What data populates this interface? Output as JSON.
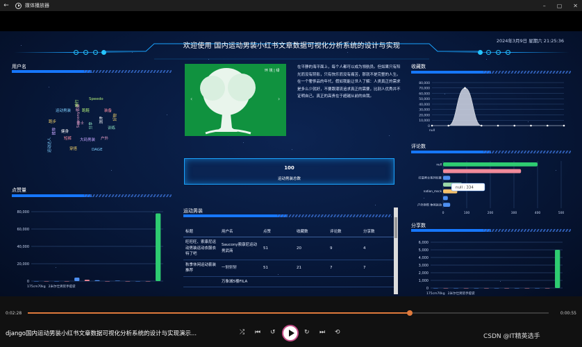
{
  "window": {
    "title": "媒体播放器",
    "back": "←",
    "minimize": "–",
    "maximize": "▢",
    "close": "✕"
  },
  "dashboard": {
    "title": "欢迎使用 国内运动男装小红书文章数据可视化分析系统的设计与实现",
    "datetime": "2024年3月9日 星期六 21:25:36",
    "panels": {
      "username": "用户名",
      "likes": "点赞量",
      "favorites": "收藏数",
      "comments": "评论数",
      "shares": "分享数",
      "sports_menswear": "运动男装"
    },
    "wordcloud": [
      "Saucony索康",
      "运动男装",
      "跑步",
      "骑行",
      "健身",
      "装备",
      "分享",
      "大码男装",
      "户外",
      "运动达人",
      "穿搭",
      "Speedo",
      "测评",
      "短裤",
      "训练",
      "推荐",
      "男士",
      "DAGE",
      "好物",
      "跑鞋"
    ],
    "image_overlay_text": "环 境 | 绿",
    "intro": "在平静的海平面上，每个人都可以成为领航员。但如果只有阳光而没有阴影，只有快乐而没有痛苦，那就不是完整的人生。在一个奢侈品的年代，假如我能让世人了解：人类真正的需求是多么少就好，不要跟潮流追求真正的需要，比别人优秀并不证明自己。真正的高贵在于超越从前的自我。",
    "stat": {
      "value": "100",
      "label": "运动男装总数"
    },
    "table": {
      "headers": [
        "标题",
        "用户名",
        "点赞",
        "收藏数",
        "评论数",
        "分享数"
      ],
      "rows": [
        [
          "旺旺旺、索康尼运动男装运动衣服衣特了吧",
          "Saucony索康尼运动男武商",
          "51",
          "20",
          "9",
          "4"
        ],
        [
          "秋季休闲运动套装推荐",
          "一轩轩轩",
          "51",
          "21",
          "7",
          "7"
        ],
        [
          "",
          "万象城5楼FILA",
          "",
          "",
          "",
          ""
        ]
      ]
    },
    "tooltip": "null : 334"
  },
  "player": {
    "current_time": "0:02:28",
    "end_time": "0:00:55",
    "progress": 0.733,
    "video_title": "django国内运动男装小红书文章数据可视化分析系统的设计与实现演示...",
    "watermark": "CSDN @IT精英选手",
    "controls": {
      "shuffle": "⤮",
      "prev": "⏮",
      "back10": "↺",
      "forward30": "↻",
      "next": "⏭",
      "repeat": "⟲"
    }
  },
  "colors": {
    "accent": "#1aa4ff",
    "green": "#2ecc71",
    "pink": "#f08a9a",
    "bar_blue": "#4e8ff0"
  },
  "chart_data": [
    {
      "id": "likes",
      "type": "bar",
      "title": "",
      "categories": [
        "175cm70kg",
        "2米尔仕男装手提袋",
        "",
        "",
        "",
        "",
        "",
        "",
        "",
        "",
        "",
        "",
        ""
      ],
      "values": [
        0,
        0,
        0,
        0,
        4000,
        1500,
        1000,
        0,
        500,
        0,
        0,
        0,
        78000
      ],
      "ylim": [
        0,
        80000
      ],
      "yticks": [
        0,
        20000,
        40000,
        60000,
        80000
      ]
    },
    {
      "id": "favorites",
      "type": "area",
      "title": "",
      "categories": [
        "null",
        "",
        "",
        "",
        "",
        "",
        "",
        "",
        ""
      ],
      "values": [
        0,
        0,
        70000,
        0,
        0,
        0,
        0,
        0,
        0
      ],
      "ylim": [
        0,
        80000
      ],
      "yticks": [
        0,
        10000,
        20000,
        30000,
        40000,
        50000,
        60000,
        70000,
        80000
      ]
    },
    {
      "id": "comments",
      "type": "bar",
      "categories": [
        "null",
        "",
        "打造男士系列长裤",
        "",
        "nation_msck",
        "",
        "户外穿搭 休闲运动"
      ],
      "values": [
        400,
        330,
        30,
        80,
        60,
        20,
        30
      ],
      "xlim": [
        0,
        500
      ],
      "xticks": [
        0,
        100,
        200,
        300,
        400,
        500
      ]
    },
    {
      "id": "shares",
      "type": "bar",
      "title": "",
      "categories": [
        "175cm70kg",
        "2米尔仕男装手提袋",
        "",
        "",
        "",
        "",
        "",
        "",
        "",
        "",
        "",
        "",
        ""
      ],
      "values": [
        0,
        0,
        0,
        0,
        0,
        0,
        0,
        0,
        0,
        0,
        0,
        0,
        5000
      ],
      "ylim": [
        0,
        6000
      ],
      "yticks": [
        0,
        1000,
        2000,
        3000,
        4000,
        5000,
        6000
      ]
    }
  ]
}
